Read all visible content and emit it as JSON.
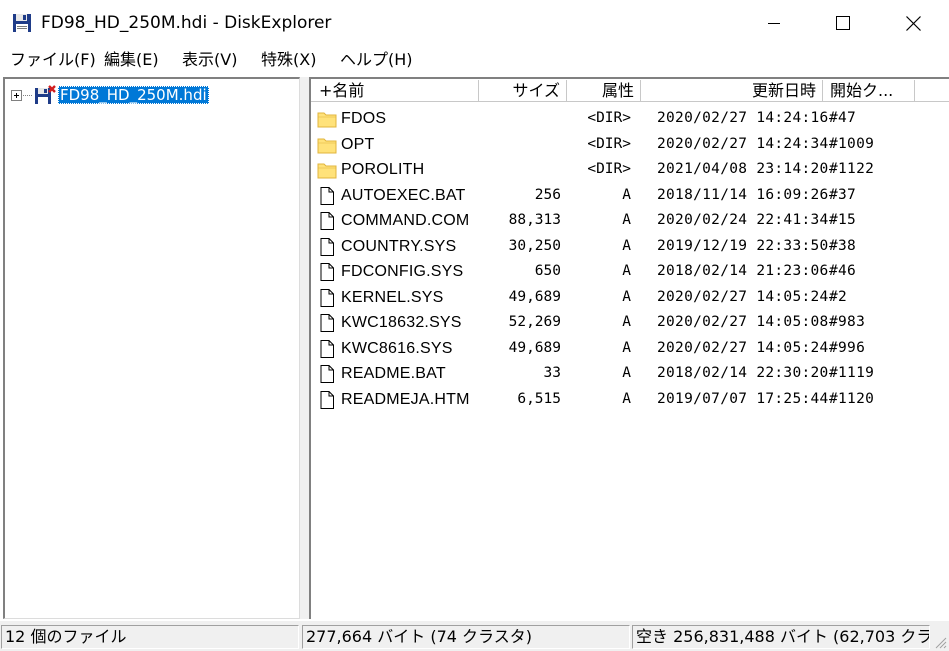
{
  "window": {
    "title": "FD98_HD_250M.hdi - DiskExplorer"
  },
  "menu": [
    {
      "label": "ファイル(F)"
    },
    {
      "label": "編集(E)"
    },
    {
      "label": "表示(V)"
    },
    {
      "label": "特殊(X)"
    },
    {
      "label": "ヘルプ(H)"
    }
  ],
  "tree": {
    "root_label": "FD98_HD_250M.hdi",
    "root_icon": "disk-image-icon",
    "selected_color": "#0078d7"
  },
  "list": {
    "headers": {
      "name": "+名前",
      "size": "サイズ",
      "attr": "属性",
      "date": "更新日時",
      "cluster": "開始ク..."
    },
    "rows": [
      {
        "icon": "folder-icon",
        "name": "FDOS",
        "size": "",
        "attr": "<DIR>",
        "date": "2020/02/27 14:24:16",
        "cluster": "#47"
      },
      {
        "icon": "folder-icon",
        "name": "OPT",
        "size": "",
        "attr": "<DIR>",
        "date": "2020/02/27 14:24:34",
        "cluster": "#1009"
      },
      {
        "icon": "folder-icon",
        "name": "POROLITH",
        "size": "",
        "attr": "<DIR>",
        "date": "2021/04/08 23:14:20",
        "cluster": "#1122"
      },
      {
        "icon": "file-icon",
        "name": "AUTOEXEC.BAT",
        "size": "256",
        "attr": "A",
        "date": "2018/11/14 16:09:26",
        "cluster": "#37"
      },
      {
        "icon": "file-icon",
        "name": "COMMAND.COM",
        "size": "88,313",
        "attr": "A",
        "date": "2020/02/24 22:41:34",
        "cluster": "#15"
      },
      {
        "icon": "file-icon",
        "name": "COUNTRY.SYS",
        "size": "30,250",
        "attr": "A",
        "date": "2019/12/19 22:33:50",
        "cluster": "#38"
      },
      {
        "icon": "file-icon",
        "name": "FDCONFIG.SYS",
        "size": "650",
        "attr": "A",
        "date": "2018/02/14 21:23:06",
        "cluster": "#46"
      },
      {
        "icon": "file-icon",
        "name": "KERNEL.SYS",
        "size": "49,689",
        "attr": "A",
        "date": "2020/02/27 14:05:24",
        "cluster": "#2"
      },
      {
        "icon": "file-icon",
        "name": "KWC18632.SYS",
        "size": "52,269",
        "attr": "A",
        "date": "2020/02/27 14:05:08",
        "cluster": "#983"
      },
      {
        "icon": "file-icon",
        "name": "KWC8616.SYS",
        "size": "49,689",
        "attr": "A",
        "date": "2020/02/27 14:05:24",
        "cluster": "#996"
      },
      {
        "icon": "file-icon",
        "name": "README.BAT",
        "size": "33",
        "attr": "A",
        "date": "2018/02/14 22:30:20",
        "cluster": "#1119"
      },
      {
        "icon": "file-icon",
        "name": "READMEJA.HTM",
        "size": "6,515",
        "attr": "A",
        "date": "2019/07/07 17:25:44",
        "cluster": "#1120"
      }
    ]
  },
  "status": {
    "file_count": "12 個のファイル",
    "used": "277,664 バイト (74 クラスタ)",
    "free": "空き 256,831,488 バイト (62,703 クラス"
  },
  "colors": {
    "folder": "#ffe27a",
    "folder_edge": "#e0b43c",
    "selection": "#0078d7"
  }
}
